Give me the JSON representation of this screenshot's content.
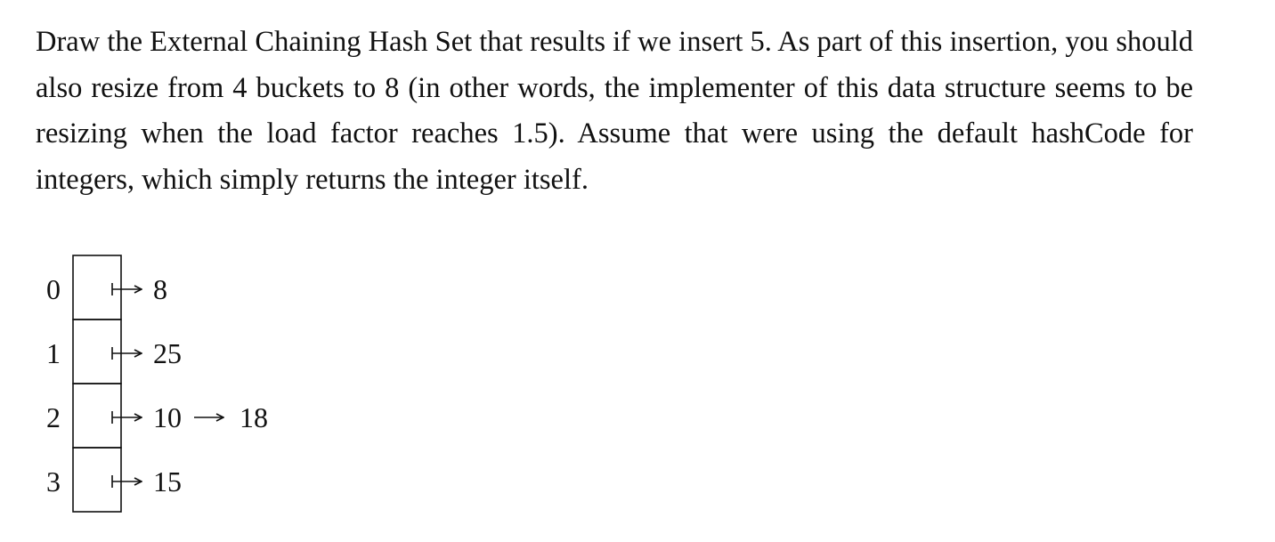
{
  "question": {
    "text": "Draw the External Chaining Hash Set that results if we insert 5. As part of this insertion, you should also resize from 4 buckets to 8 (in other words, the implementer of this data structure seems to be resizing when the load factor reaches 1.5). Assume that were using the default hashCode for integers, which simply returns the integer itself."
  },
  "hash_set": {
    "buckets": [
      {
        "index": "0",
        "items": [
          "8"
        ]
      },
      {
        "index": "1",
        "items": [
          "25"
        ]
      },
      {
        "index": "2",
        "items": [
          "10",
          "18"
        ]
      },
      {
        "index": "3",
        "items": [
          "15"
        ]
      }
    ]
  }
}
